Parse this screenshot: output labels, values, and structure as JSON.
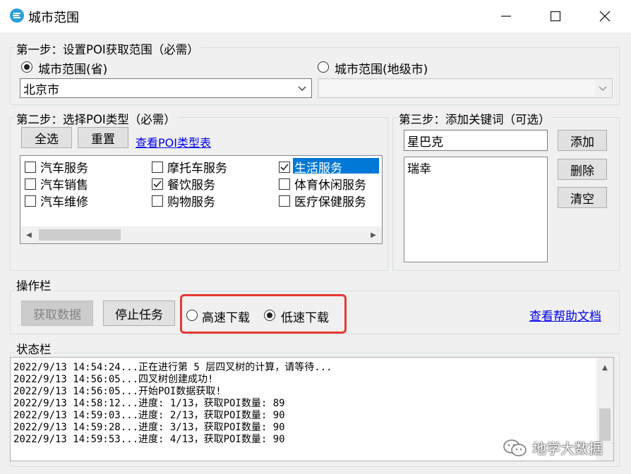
{
  "window": {
    "title": "城市范围",
    "app_icon": "globe-e-icon",
    "controls": {
      "minimize": "—",
      "maximize": "☐",
      "close": "✕"
    }
  },
  "step1": {
    "legend": "第一步：设置POI获取范围（必需）",
    "radio_province_label": "城市范围(省)",
    "radio_city_label": "城市范围(地级市)",
    "selected": "province",
    "province_value": "北京市",
    "city_value": ""
  },
  "step2": {
    "legend": "第二步：选择POI类型（必需）",
    "select_all_label": "全选",
    "reset_label": "重置",
    "view_types_link": "查看POI类型表",
    "categories": [
      {
        "label": "汽车服务",
        "checked": false
      },
      {
        "label": "汽车销售",
        "checked": false
      },
      {
        "label": "汽车维修",
        "checked": false
      },
      {
        "label": "摩托车服务",
        "checked": false
      },
      {
        "label": "餐饮服务",
        "checked": true
      },
      {
        "label": "购物服务",
        "checked": false
      },
      {
        "label": "生活服务",
        "checked": true,
        "selected": true
      },
      {
        "label": "体育休闲服务",
        "checked": false
      },
      {
        "label": "医疗保健服务",
        "checked": false
      }
    ]
  },
  "step3": {
    "legend": "第三步：添加关键词（可选）",
    "keyword_input": "星巴克",
    "keywords": [
      "瑞幸"
    ],
    "add_label": "添加",
    "delete_label": "删除",
    "clear_label": "清空"
  },
  "actions": {
    "legend": "操作栏",
    "fetch_label": "获取数据",
    "stop_label": "停止任务",
    "fast_download_label": "高速下载",
    "slow_download_label": "低速下载",
    "download_mode": "slow",
    "help_link": "查看帮助文档"
  },
  "status": {
    "legend": "状态栏",
    "lines": [
      "2022/9/13 14:54:24...正在进行第 5 层四叉树的计算，请等待...",
      "2022/9/13 14:56:05...四叉树创建成功!",
      "2022/9/13 14:56:05...开始POI数据获取!",
      "2022/9/13 14:58:12...进度: 1/13，获取POI数量: 89",
      "2022/9/13 14:59:03...进度: 2/13，获取POI数量: 90",
      "2022/9/13 14:59:28...进度: 3/13，获取POI数量: 90",
      "2022/9/13 14:59:53...进度: 4/13，获取POI数量: 90"
    ]
  },
  "watermark": {
    "text": "地学大数据",
    "icon": "wechat-icon"
  },
  "colors": {
    "highlight": "#e53935",
    "selection": "#0078d7",
    "link": "#0000ee"
  }
}
